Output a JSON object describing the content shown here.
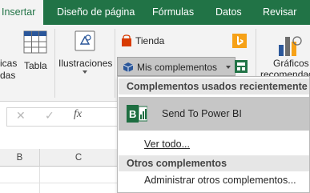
{
  "tabs": [
    {
      "label": "Insertar",
      "active": true
    },
    {
      "label": "Diseño de página",
      "active": false
    },
    {
      "label": "Fórmulas",
      "active": false
    },
    {
      "label": "Datos",
      "active": false
    },
    {
      "label": "Revisar",
      "active": false
    }
  ],
  "ribbon": {
    "cut_left_label_1": "icas",
    "cut_left_label_2": "das",
    "tabla_label": "Tabla",
    "ilustraciones_label": "Ilustraciones",
    "tienda_label": "Tienda",
    "mis_complementos_label": "Mis complementos",
    "graficos_label_1": "Gráficos",
    "graficos_label_2": "recomendad"
  },
  "formula_bar": {
    "cancel_glyph": "✕",
    "enter_glyph": "✓",
    "fx_label": "fx"
  },
  "grid": {
    "columns": [
      "B",
      "C"
    ]
  },
  "dropdown": {
    "recent_header": "Complementos usados recientemente",
    "recent_items": [
      {
        "label": "Send To Power BI",
        "icon": "power-bi-icon"
      }
    ],
    "see_all_label": "Ver todo...",
    "other_header": "Otros complementos",
    "manage_label": "Administrar otros complementos..."
  },
  "colors": {
    "brand_green": "#217346",
    "store_red": "#d83b01",
    "bing_orange": "#f6a117",
    "addin_blue": "#2b579a",
    "powerbi_green": "#1e6e41"
  }
}
